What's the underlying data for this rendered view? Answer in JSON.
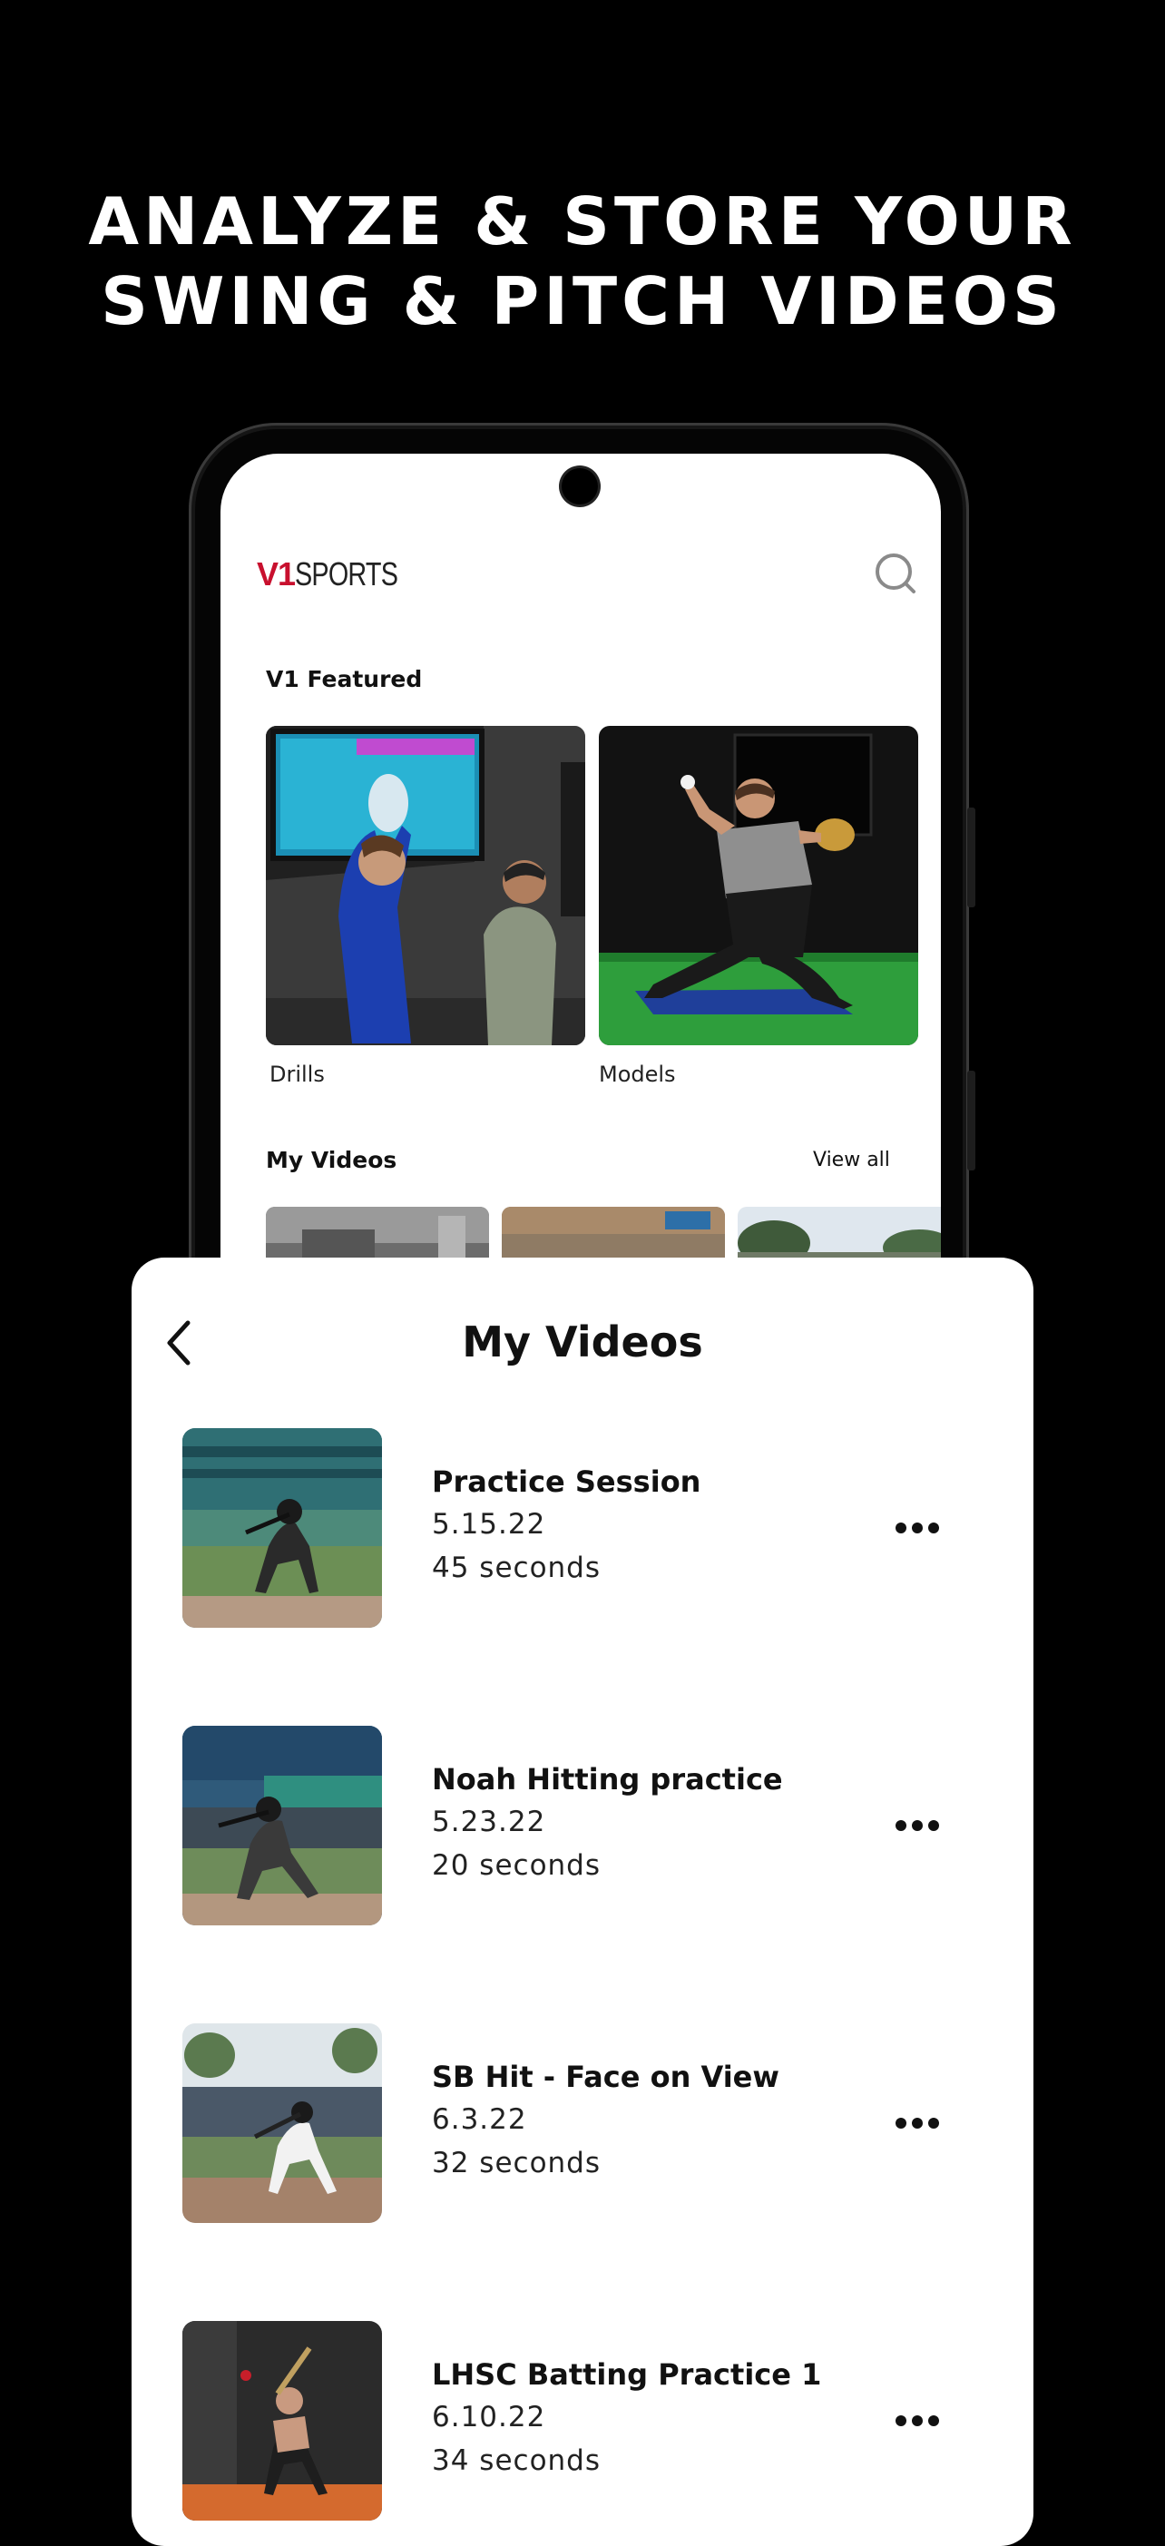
{
  "headline": {
    "line1": "ANALYZE & STORE YOUR",
    "line2": "SWING & PITCH VIDEOS"
  },
  "app": {
    "logo_v1": "V1",
    "logo_sports": "SPORTS",
    "featured_title": "V1 Featured",
    "featured": [
      {
        "label": "Drills"
      },
      {
        "label": "Models"
      }
    ],
    "my_videos_title": "My Videos",
    "view_all": "View all"
  },
  "sheet": {
    "title": "My Videos",
    "videos": [
      {
        "title": "Practice Session",
        "date": "5.15.22",
        "duration": "45 seconds"
      },
      {
        "title": "Noah Hitting practice",
        "date": "5.23.22",
        "duration": "20 seconds"
      },
      {
        "title": "SB Hit - Face on View",
        "date": "6.3.22",
        "duration": "32 seconds"
      },
      {
        "title": "LHSC Batting Practice 1",
        "date": "6.10.22",
        "duration": "34 seconds"
      }
    ]
  },
  "icons": {
    "search": "search-icon",
    "back": "chevron-left-icon",
    "more": "more-horizontal-icon",
    "camera": "camera-hole"
  },
  "colors": {
    "brand_red": "#c8102e",
    "background": "#000000",
    "sheet": "#ffffff"
  }
}
